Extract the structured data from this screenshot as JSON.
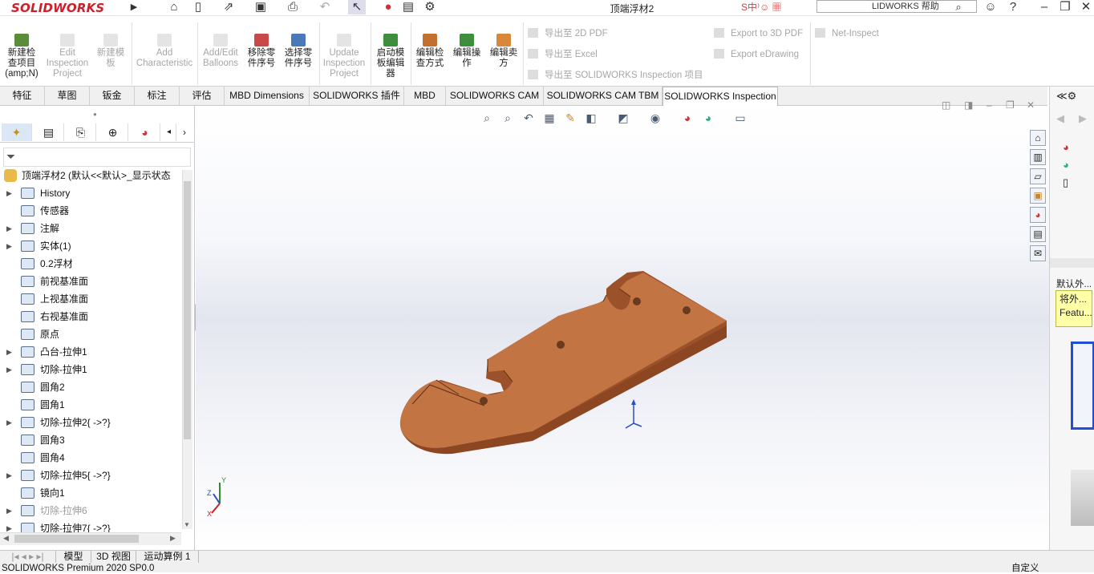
{
  "app": {
    "logo_text": "SOLIDWORKS",
    "document_title": "顶端浮材2",
    "help_search_placeholder": "LIDWORKS 帮助"
  },
  "ribbon": {
    "big_buttons": [
      {
        "label": "新建检查项目(amp;N)",
        "lines": [
          "新建检",
          "查项目",
          "(amp;N)"
        ],
        "enabled": true
      },
      {
        "label": "Edit Inspection Project",
        "lines": [
          "Edit",
          "Inspection",
          "Project"
        ],
        "enabled": false
      },
      {
        "label": "新建模板",
        "lines": [
          "新建模",
          "板"
        ],
        "enabled": false
      },
      {
        "label": "Add Characteristic",
        "lines": [
          "Add",
          "Characteristic"
        ],
        "enabled": false
      },
      {
        "label": "Add/Edit Balloons",
        "lines": [
          "Add/Edit",
          "Balloons"
        ],
        "enabled": false
      },
      {
        "label": "移除零件序号",
        "lines": [
          "移除零",
          "件序号"
        ],
        "enabled": true
      },
      {
        "label": "选择零件序号",
        "lines": [
          "选择零",
          "件序号"
        ],
        "enabled": true
      },
      {
        "label": "Update Inspection Project",
        "lines": [
          "Update",
          "Inspection",
          "Project"
        ],
        "enabled": false
      },
      {
        "label": "启动模板编辑器",
        "lines": [
          "启动模",
          "板编辑",
          "器"
        ],
        "enabled": true
      },
      {
        "label": "编辑检查方式",
        "lines": [
          "编辑检",
          "查方式"
        ],
        "enabled": true
      },
      {
        "label": "编辑操作",
        "lines": [
          "编辑操",
          "作"
        ],
        "enabled": true
      },
      {
        "label": "编辑卖方",
        "lines": [
          "编辑卖",
          "方"
        ],
        "enabled": true
      }
    ],
    "export_col1": [
      "导出至 2D PDF",
      "导出至 Excel",
      "导出至 SOLIDWORKS Inspection 项目"
    ],
    "export_col2": [
      "Export to 3D PDF",
      "Export eDrawing"
    ],
    "export_col3": [
      "Net-Inspect"
    ]
  },
  "command_tabs": [
    "特征",
    "草图",
    "钣金",
    "标注",
    "评估",
    "MBD Dimensions",
    "SOLIDWORKS 插件",
    "MBD",
    "SOLIDWORKS CAM",
    "SOLIDWORKS CAM TBM",
    "SOLIDWORKS Inspection"
  ],
  "active_tab": "SOLIDWORKS Inspection",
  "feature_tree": {
    "root": "顶端浮材2 (默认<<默认>_显示状态",
    "items": [
      {
        "label": "History",
        "expandable": true,
        "dim": false
      },
      {
        "label": "传感器",
        "expandable": false,
        "dim": false
      },
      {
        "label": "注解",
        "expandable": true,
        "dim": false
      },
      {
        "label": "实体(1)",
        "expandable": true,
        "dim": false
      },
      {
        "label": "0.2浮材",
        "expandable": false,
        "dim": false
      },
      {
        "label": "前视基准面",
        "expandable": false,
        "dim": false
      },
      {
        "label": "上视基准面",
        "expandable": false,
        "dim": false
      },
      {
        "label": "右视基准面",
        "expandable": false,
        "dim": false
      },
      {
        "label": "原点",
        "expandable": false,
        "dim": false
      },
      {
        "label": "凸台-拉伸1",
        "expandable": true,
        "dim": false
      },
      {
        "label": "切除-拉伸1",
        "expandable": true,
        "dim": false
      },
      {
        "label": "圆角2",
        "expandable": false,
        "dim": false
      },
      {
        "label": "圆角1",
        "expandable": false,
        "dim": false
      },
      {
        "label": "切除-拉伸2{ ->?}",
        "expandable": true,
        "dim": false
      },
      {
        "label": "圆角3",
        "expandable": false,
        "dim": false
      },
      {
        "label": "圆角4",
        "expandable": false,
        "dim": false
      },
      {
        "label": "切除-拉伸5{ ->?}",
        "expandable": true,
        "dim": false
      },
      {
        "label": "镜向1",
        "expandable": false,
        "dim": false
      },
      {
        "label": "切除-拉伸6",
        "expandable": true,
        "dim": true
      },
      {
        "label": "切除-拉伸7{ ->?}",
        "expandable": true,
        "dim": false
      }
    ]
  },
  "axis": {
    "x": "X",
    "y": "Y",
    "z": "Z"
  },
  "task_pane": {
    "panel_label": "默认外...",
    "tooltip_lines": [
      "将外...",
      "Featu..."
    ]
  },
  "bottom_tabs": [
    "模型",
    "3D 视图",
    "运动算例 1"
  ],
  "status": {
    "left": "SOLIDWORKS Premium 2020 SP0.0",
    "right": "自定义"
  },
  "colors": {
    "part": "#b96a3c",
    "part_top": "#c97a4a",
    "accent": "#cc1f2b",
    "tooltip_bg": "#ffffa8"
  }
}
